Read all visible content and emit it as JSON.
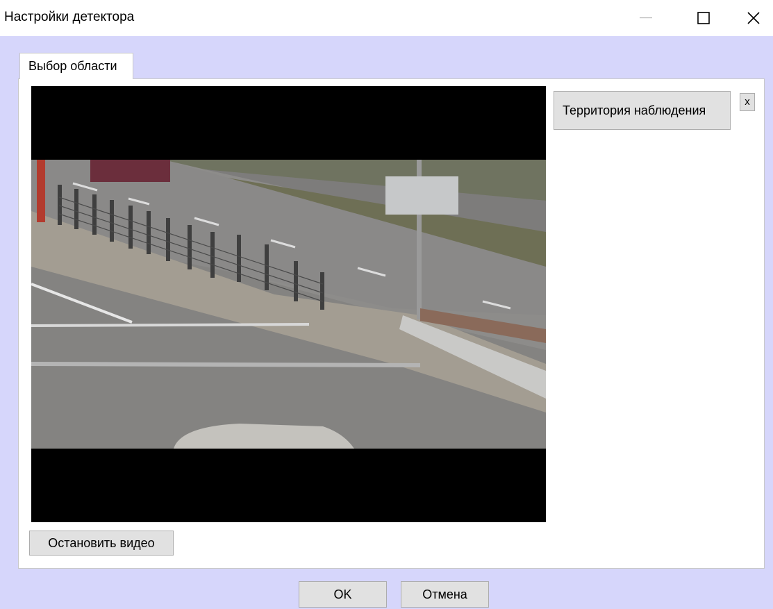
{
  "window": {
    "title": "Настройки детектора",
    "minimize_icon": "minimize-icon",
    "maximize_icon": "maximize-icon",
    "close_icon": "close-icon"
  },
  "tabs": [
    {
      "label": "Выбор области",
      "selected": true
    }
  ],
  "zones": {
    "items": [
      {
        "label": "Территория наблюдения",
        "remove_label": "x"
      }
    ]
  },
  "video": {
    "stop_label": "Остановить видео"
  },
  "footer": {
    "ok_label": "OK",
    "cancel_label": "Отмена"
  },
  "colors": {
    "client_background": "#d6d6fb",
    "button_face": "#e1e1e1",
    "button_border": "#adadad",
    "video_letterbox": "#000000"
  }
}
